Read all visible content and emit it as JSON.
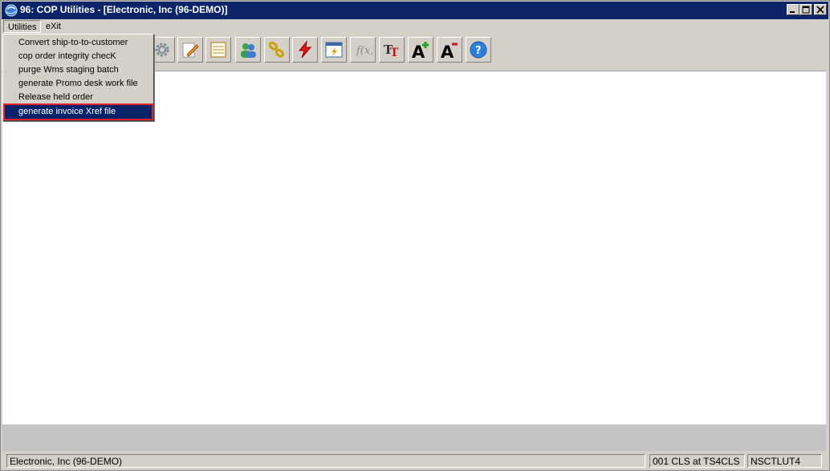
{
  "window": {
    "title": "96: COP Utilities - [Electronic, Inc (96-DEMO)]"
  },
  "menubar": {
    "items": [
      {
        "label": "Utilities"
      },
      {
        "label": "eXit"
      }
    ]
  },
  "utilities_menu": {
    "items": [
      {
        "label": "Convert ship-to-to-customer"
      },
      {
        "label": "cop order integrity checK"
      },
      {
        "label": "purge Wms staging batch"
      },
      {
        "label": "generate Promo desk work file"
      },
      {
        "label": "Release held order"
      },
      {
        "label": "generate invoice Xref file",
        "selected": true
      }
    ]
  },
  "toolbar": {
    "icons": [
      "gear-icon",
      "edit-pencil-icon",
      "list-window-icon",
      "users-icon",
      "link-chain-icon",
      "lightning-icon",
      "calendar-refresh-icon",
      "function-icon",
      "font-size-icon",
      "font-increase-icon",
      "font-decrease-icon",
      "help-icon"
    ]
  },
  "statusbar": {
    "company": "Electronic, Inc (96-DEMO)",
    "session": "001 CLS at TS4CLS",
    "program": "NSCTLUT4"
  },
  "colors": {
    "titlebar": "#0b246a",
    "selection": "#0a246a",
    "highlight_outline": "#e0202a",
    "chrome": "#d4d0c8"
  }
}
